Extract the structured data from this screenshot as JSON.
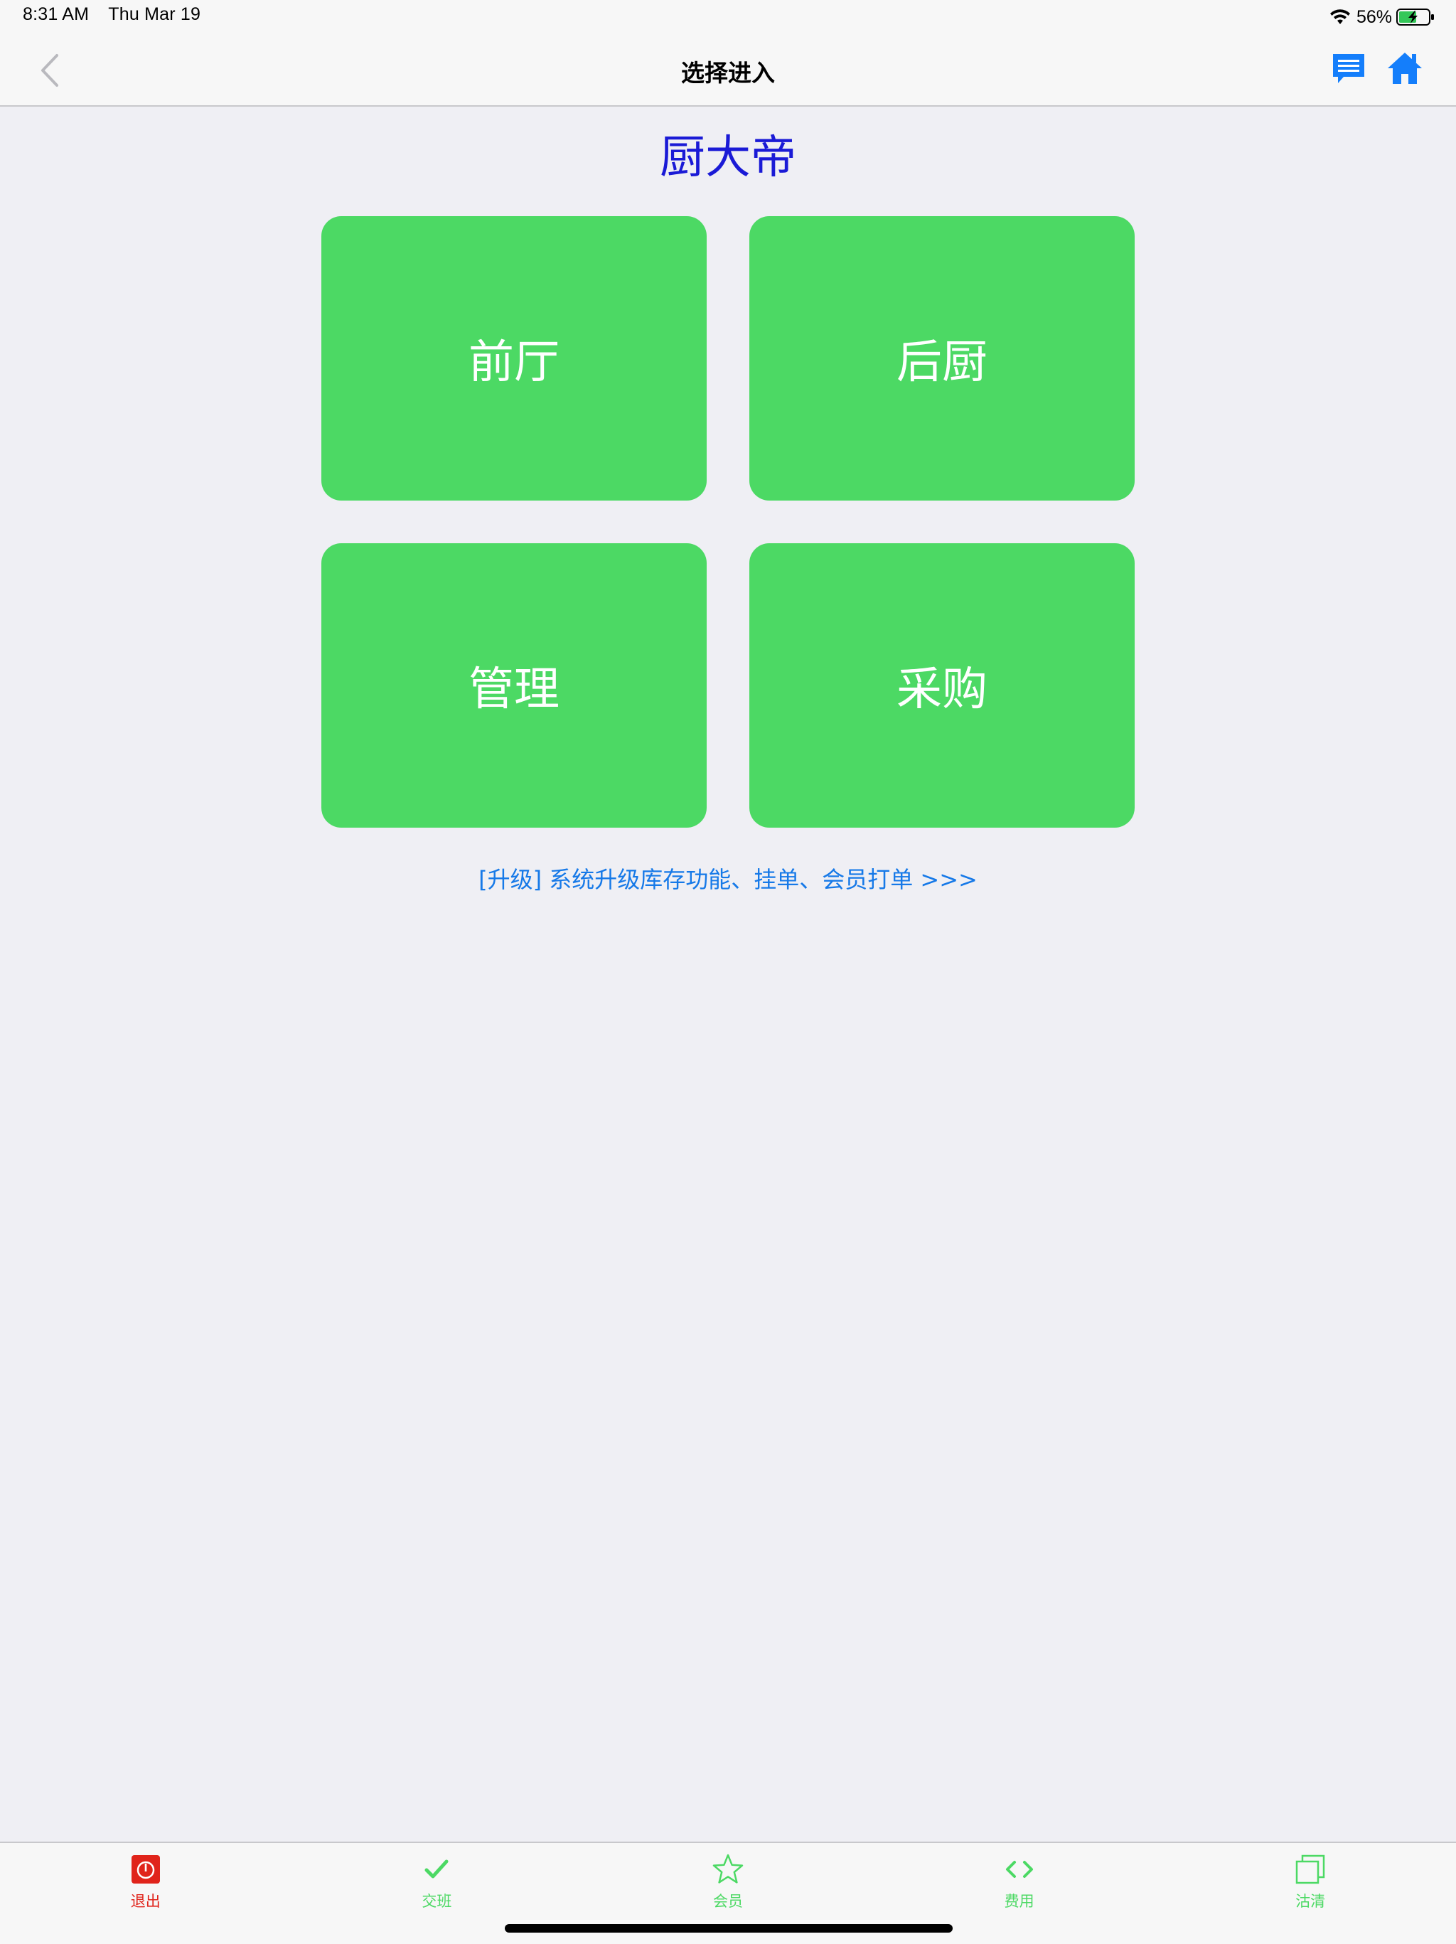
{
  "status_bar": {
    "time": "8:31 AM",
    "date": "Thu Mar 19",
    "battery": "56%",
    "icons": [
      "wifi-icon",
      "battery-charging-icon"
    ]
  },
  "nav": {
    "title": "选择进入",
    "icons": [
      "chevron-left-icon",
      "message-icon",
      "home-icon"
    ]
  },
  "brand": {
    "title": "厨大帝"
  },
  "tiles": [
    {
      "label": "前厅"
    },
    {
      "label": "后厨"
    },
    {
      "label": "管理"
    },
    {
      "label": "采购"
    }
  ],
  "upgrade": {
    "text": "[升级] 系统升级库存功能、挂单、会员打单 >>>"
  },
  "tabs": [
    {
      "label": "退出",
      "icon": "power-icon"
    },
    {
      "label": "交班",
      "icon": "checkmark-icon"
    },
    {
      "label": "会员",
      "icon": "star-icon"
    },
    {
      "label": "费用",
      "icon": "code-icon"
    },
    {
      "label": "沽清",
      "icon": "copy-icon"
    }
  ],
  "colors": {
    "tile_green": "#4cd964",
    "brand_blue": "#1a1ad6",
    "link_blue": "#1679e8",
    "nav_icon_blue": "#147efb",
    "exit_red": "#e0241b"
  }
}
